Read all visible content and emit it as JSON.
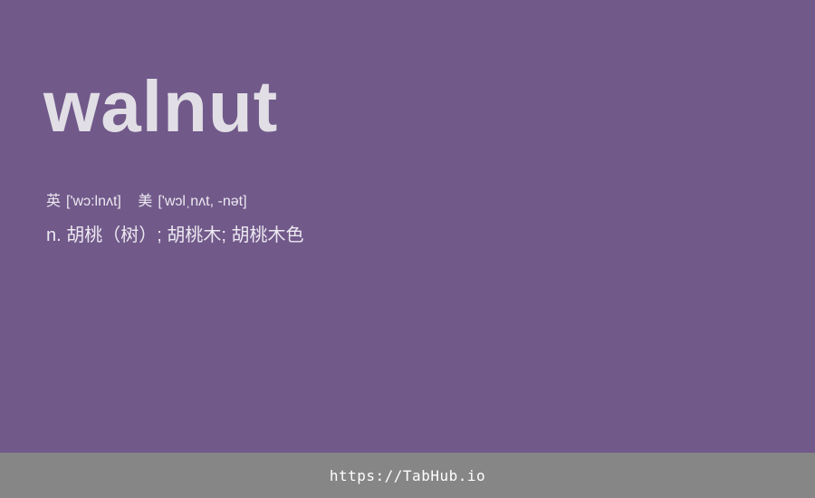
{
  "card": {
    "word": "walnut",
    "phonetics": {
      "uk": {
        "label": "英",
        "ipa": "['wɔ:lnʌt]"
      },
      "us": {
        "label": "美",
        "ipa": "['wɔlˌnʌt, -nət]"
      }
    },
    "definition": "n. 胡桃（树）; 胡桃木; 胡桃木色"
  },
  "footer": {
    "link_text": "https://TabHub.io"
  },
  "colors": {
    "background": "#71598a",
    "footer_background": "#868686",
    "word_color": "#e1dfe5"
  }
}
